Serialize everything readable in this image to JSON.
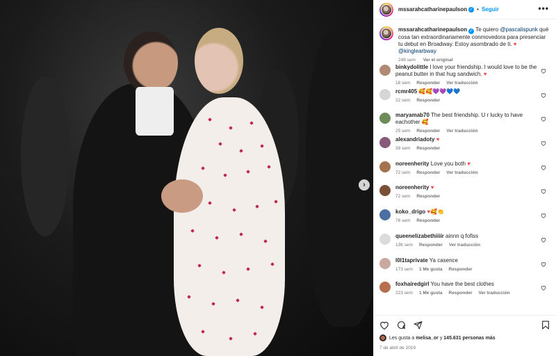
{
  "post": {
    "username": "mssarahcatharinepaulson",
    "follow_label": "Seguir",
    "more_label": "•••",
    "next_label": "›"
  },
  "caption": {
    "username": "mssarahcatharinepaulson",
    "text_a": " Te quiero ",
    "mention_a": "@pascalispunk",
    "text_b": " qué cosa tan extraordinariamente conmovedora para presenciar tu debut en Broadway. Estoy asombrado de ti. ",
    "mention_b": "@kinglearbway",
    "time": "249 sem",
    "translate": "Ver el original"
  },
  "comments": [
    {
      "user": "binkydolittle",
      "text": "I love your friendship. I would love to be the peanut butter in that hug sandwich. ",
      "emoji": "♥",
      "time": "18 sem",
      "reply": "Responder",
      "translate": "Ver traducción",
      "likes": ""
    },
    {
      "user": "rcmr405",
      "text": "",
      "emoji": "🥰🥰💜💜💙💙",
      "time": "22 sem",
      "reply": "Responder",
      "translate": "",
      "likes": ""
    },
    {
      "user": "maryamab70",
      "text": "The best friendship. U r lucky to have eachother ",
      "emoji": "🥰",
      "time": "25 sem",
      "reply": "Responder",
      "translate": "Ver traducción",
      "likes": ""
    },
    {
      "user": "alexandriadoty",
      "text": "",
      "emoji": "♥",
      "time": "39 sem",
      "reply": "Responder",
      "translate": "",
      "likes": ""
    },
    {
      "user": "noreenherity",
      "text": "Love you both ",
      "emoji": "♥",
      "time": "72 sem",
      "reply": "Responder",
      "translate": "Ver traducción",
      "likes": ""
    },
    {
      "user": "noreenherity",
      "text": "",
      "emoji": "♥",
      "time": "72 sem",
      "reply": "Responder",
      "translate": "",
      "likes": ""
    },
    {
      "user": "koko_drigo",
      "text": "",
      "emoji": "♥🥰👏",
      "time": "76 sem",
      "reply": "Responder",
      "translate": "",
      "likes": ""
    },
    {
      "user": "queenelizabethiiiir",
      "text": "ainnn q fofiss",
      "emoji": "",
      "time": "136 sem",
      "reply": "Responder",
      "translate": "Ver traducción",
      "likes": ""
    },
    {
      "user": "l0l1taprivate",
      "text": "Ya casence",
      "emoji": "",
      "time": "173 sem",
      "reply": "Responder",
      "translate": "",
      "likes": "1 Me gusta"
    },
    {
      "user": "foxhairedgirl",
      "text": "You have the best clothes",
      "emoji": "",
      "time": "223 sem",
      "reply": "Responder",
      "translate": "Ver traducción",
      "likes": "1 Me gusta"
    }
  ],
  "likes": {
    "prefix": "Les gusta a ",
    "user": "melisa_or",
    "middle": " y ",
    "count": "145.631 personas más"
  },
  "date": "7 de abril de 2019",
  "colors": {
    "accent": "#0095f6",
    "heart": "#ed4956",
    "muted": "#737373"
  }
}
